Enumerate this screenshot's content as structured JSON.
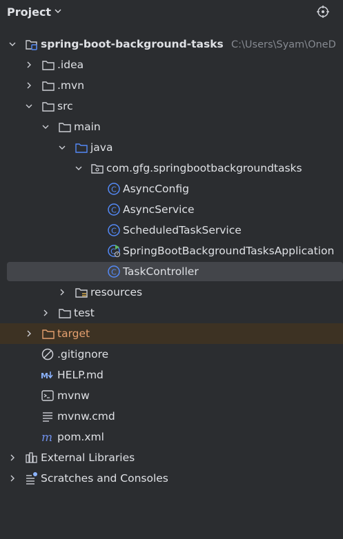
{
  "header": {
    "title": "Project"
  },
  "tree": {
    "root_label": "spring-boot-background-tasks",
    "root_path": "C:\\Users\\Syam\\OneD",
    "idea": ".idea",
    "mvn": ".mvn",
    "src": "src",
    "main": "main",
    "java": "java",
    "package": "com.gfg.springbootbackgroundtasks",
    "async_config": "AsyncConfig",
    "async_service": "AsyncService",
    "scheduled_task_service": "ScheduledTaskService",
    "application": "SpringBootBackgroundTasksApplication",
    "task_controller": "TaskController",
    "resources": "resources",
    "test": "test",
    "target": "target",
    "gitignore": ".gitignore",
    "help_md": "HELP.md",
    "mvnw": "mvnw",
    "mvnw_cmd": "mvnw.cmd",
    "pom": "pom.xml",
    "external_libraries": "External Libraries",
    "scratches": "Scratches and Consoles"
  },
  "colors": {
    "background": "#2b2d30",
    "text": "#dfe1e5",
    "selected_row": "#43454a",
    "excluded_row": "#3d3223",
    "excluded_text": "#e5a06f",
    "class_icon": "#548af7",
    "muted": "#868a91"
  },
  "icons": {
    "header": [
      "chevron-down-icon",
      "locate-icon"
    ],
    "tree": [
      "module-icon",
      "folder-icon",
      "source-folder-icon",
      "package-icon",
      "class-icon",
      "spring-app-icon",
      "resources-folder-icon",
      "excluded-folder-icon",
      "ignore-file-icon",
      "markdown-icon",
      "terminal-icon",
      "text-file-icon",
      "maven-icon",
      "libraries-icon",
      "scratches-icon"
    ]
  }
}
